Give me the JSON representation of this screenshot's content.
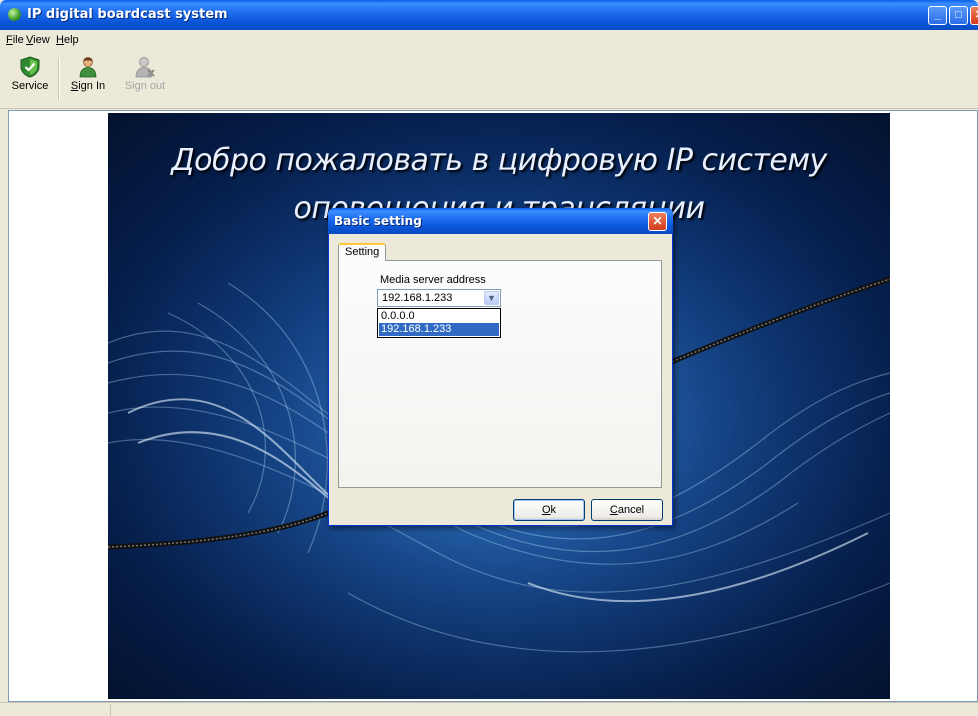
{
  "window": {
    "title": "IP digital boardcast system",
    "controls": {
      "minimize": "_",
      "maximize": "□",
      "close": "✕"
    }
  },
  "menubar": {
    "items": [
      {
        "label": "File",
        "mnemonic": "F"
      },
      {
        "label": "View",
        "mnemonic": "V"
      },
      {
        "label": "Help",
        "mnemonic": "H"
      }
    ]
  },
  "toolbar": {
    "service": {
      "label": "Service",
      "icon": "shield-check-icon"
    },
    "signin": {
      "label": "Sign In",
      "icon": "user-icon"
    },
    "signout": {
      "label": "Sign out",
      "icon": "user-remove-icon",
      "disabled": true
    }
  },
  "banner": {
    "line1": "Добро пожаловать в цифровую IP систему",
    "line2": "оповещения и трансляции"
  },
  "dialog": {
    "title": "Basic setting",
    "tab": "Setting",
    "media_server_label": "Media server address",
    "selected_value": "192.168.1.233",
    "options": [
      "0.0.0.0",
      "192.168.1.233"
    ],
    "highlighted_option": "192.168.1.233",
    "ok_label": "Ok",
    "cancel_label": "Cancel"
  },
  "colors": {
    "titlebar": "#0A5FE8",
    "window_bg": "#ECE9D8",
    "selection": "#316AC5",
    "banner_bg": "#0E3B82"
  }
}
